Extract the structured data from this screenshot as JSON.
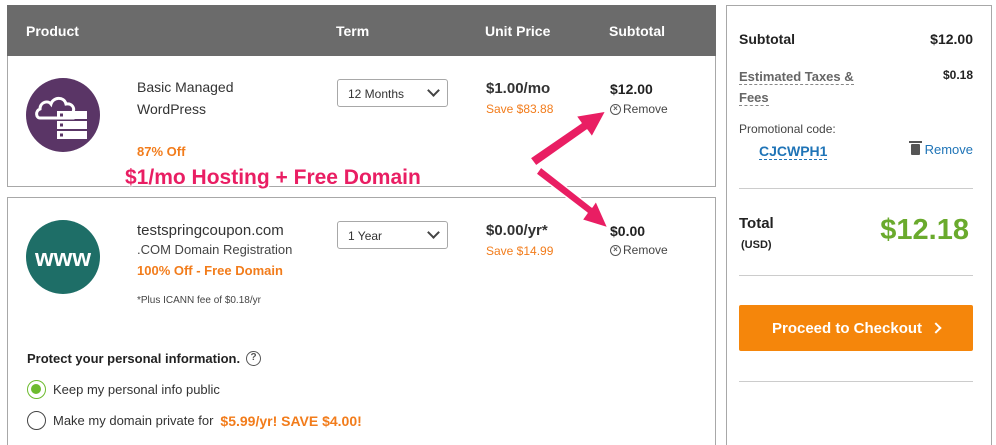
{
  "header": {
    "product": "Product",
    "term": "Term",
    "unit_price": "Unit Price",
    "subtotal": "Subtotal"
  },
  "items": [
    {
      "name": "Basic Managed WordPress",
      "sub": "",
      "discount": "87% Off",
      "term": "12 Months",
      "unit_price": "$1.00/mo",
      "save": "Save $83.88",
      "subtotal": "$12.00",
      "remove": "Remove",
      "icon": "cloud-server-icon"
    },
    {
      "name": "testspringcoupon.com",
      "sub": ".COM Domain Registration",
      "discount": "100% Off - Free Domain",
      "note": "*Plus ICANN fee of $0.18/yr",
      "term": "1 Year",
      "unit_price": "$0.00/yr*",
      "save": "Save $14.99",
      "subtotal": "$0.00",
      "remove": "Remove",
      "icon": "www-icon",
      "icon_text": "www"
    }
  ],
  "privacy": {
    "title": "Protect your personal information.",
    "option_public": "Keep my personal info public",
    "option_private": "Make my domain private for",
    "option_private_price": "$5.99/yr! SAVE $4.00!",
    "selected": "public"
  },
  "banner": "$1/mo Hosting + Free Domain",
  "summary": {
    "subtotal_label": "Subtotal",
    "subtotal_value": "$12.00",
    "taxes_label_1": "Estimated Taxes &",
    "taxes_label_2": "Fees",
    "taxes_value": "$0.18",
    "promo_label": "Promotional code:",
    "promo_code": "CJCWPH1",
    "promo_remove": "Remove",
    "total_label": "Total",
    "total_currency": "(USD)",
    "total_value": "$12.18",
    "checkout": "Proceed to Checkout"
  },
  "colors": {
    "header_bg": "#6b6b6b",
    "accent_orange": "#f5860b",
    "discount_orange": "#f27c1b",
    "total_green": "#6aaa2d",
    "link_blue": "#1f74b7",
    "banner_pink": "#e91e63",
    "wp_icon": "#5a3566",
    "www_icon": "#1e6e67"
  }
}
